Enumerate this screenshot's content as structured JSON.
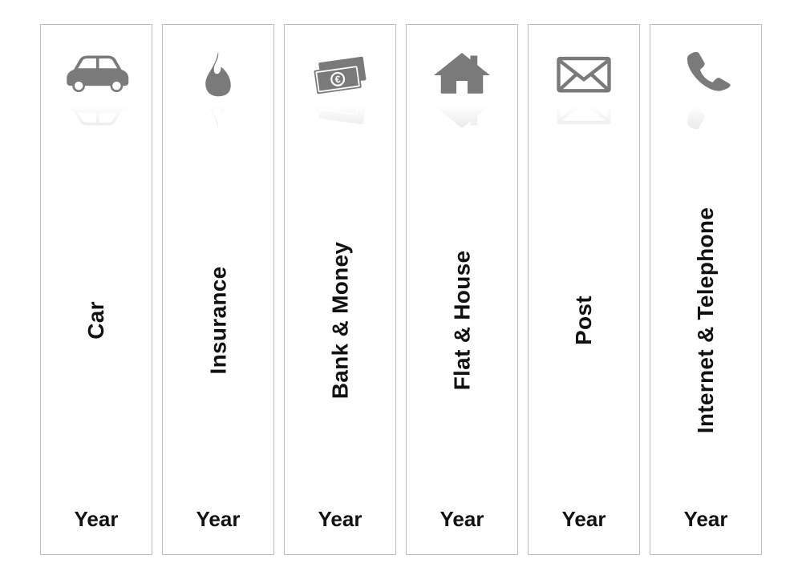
{
  "icon_color": "#7a7a7a",
  "spines": [
    {
      "icon": "car",
      "title": "Car",
      "year": "Year"
    },
    {
      "icon": "flame",
      "title": "Insurance",
      "year": "Year"
    },
    {
      "icon": "money",
      "title": "Bank & Money",
      "year": "Year"
    },
    {
      "icon": "house",
      "title": "Flat & House",
      "year": "Year"
    },
    {
      "icon": "envelope",
      "title": "Post",
      "year": "Year"
    },
    {
      "icon": "phone",
      "title": "Internet & Telephone",
      "year": "Year"
    }
  ]
}
